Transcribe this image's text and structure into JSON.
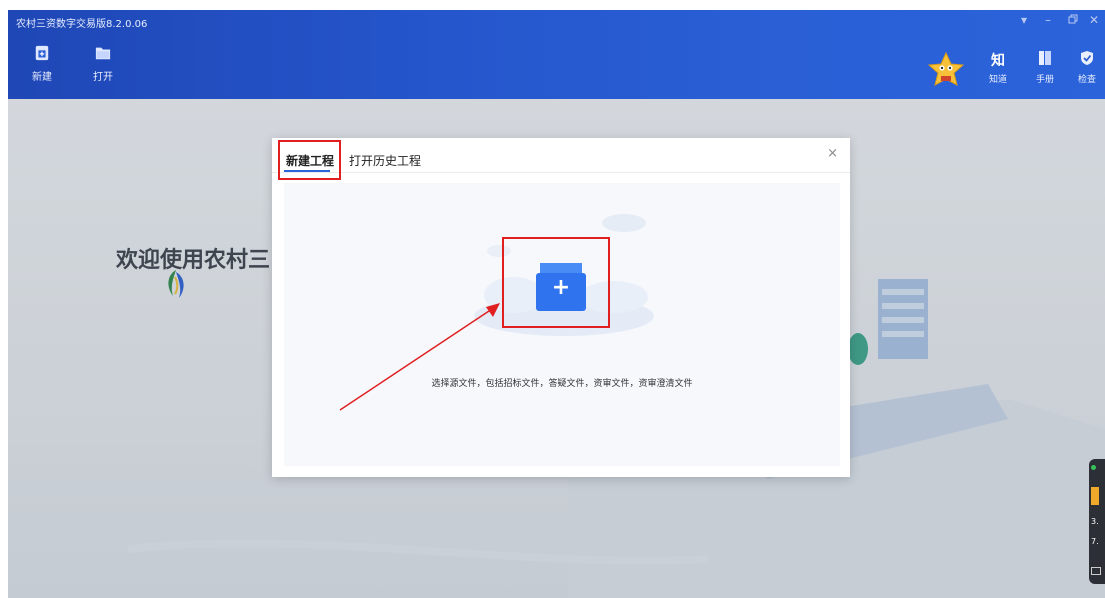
{
  "app": {
    "title": "农村三资数字交易版8.2.0.06",
    "window_controls": [
      "▾",
      "–",
      "🗗",
      "✕"
    ]
  },
  "toolbar": {
    "left": [
      {
        "label": "新建",
        "icon": "new-project-icon"
      },
      {
        "label": "打开",
        "icon": "open-folder-icon"
      }
    ],
    "right": [
      {
        "label": "知道",
        "icon_text": "知",
        "icon": "zhidao-icon"
      },
      {
        "label": "手册",
        "icon": "manual-icon"
      },
      {
        "label": "检查",
        "icon": "shield-check-icon"
      }
    ],
    "mascot_icon": "star-mascot-icon"
  },
  "background": {
    "welcome_text": "欢迎使用农村三"
  },
  "dialog": {
    "tabs": [
      {
        "label": "新建工程",
        "active": true
      },
      {
        "label": "打开历史工程",
        "active": false
      }
    ],
    "close_label": "×",
    "add_label": "+",
    "hint": "选择源文件，包括招标文件，答疑文件，资审文件，资审澄清文件"
  },
  "side_widget": {
    "values": [
      "3.",
      "7."
    ]
  },
  "colors": {
    "topbar": "#2556cc",
    "accent": "#2a66d9",
    "annotation_red": "#e02020"
  }
}
